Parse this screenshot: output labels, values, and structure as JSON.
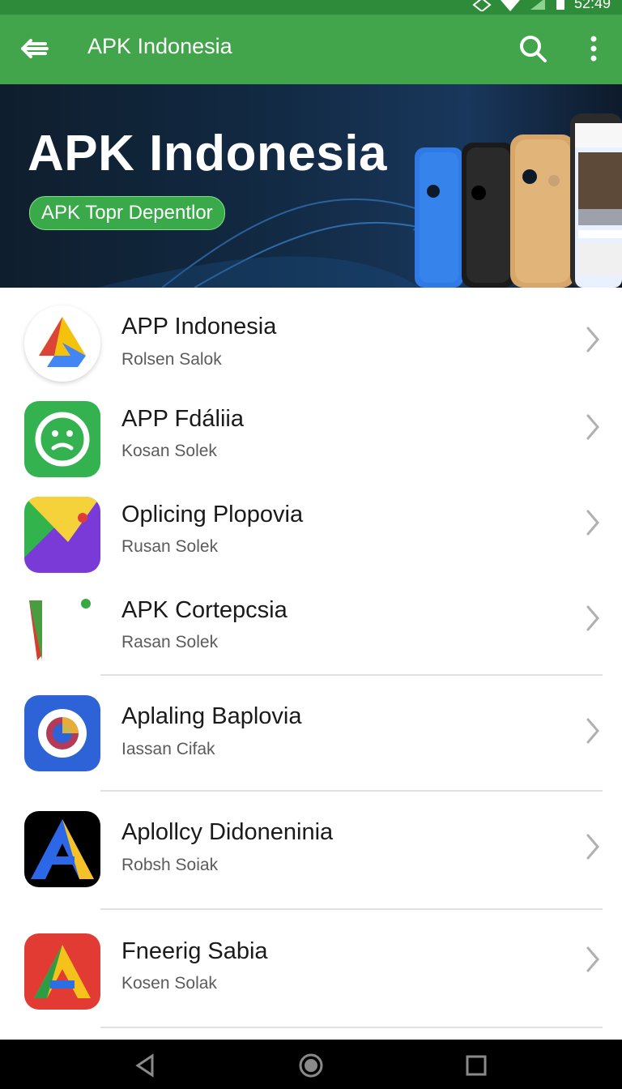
{
  "status_bar": {
    "time": "52:49"
  },
  "app_bar": {
    "title": "APK Indonesia"
  },
  "banner": {
    "headline": "APK Indonesia",
    "pill_text": "APK Topr Depentlor"
  },
  "apps": [
    {
      "title": "APP Indonesia",
      "subtitle": "Rolsen Salok"
    },
    {
      "title": "APP Fdáliia",
      "subtitle": "Kosan Solek"
    },
    {
      "title": "Oplicing Plopovia",
      "subtitle": "Rusan Solek"
    },
    {
      "title": "APK Cortepcsia",
      "subtitle": "Rasan Solek"
    },
    {
      "title": "Aplaling Baplovia",
      "subtitle": "Iassan Cifak"
    },
    {
      "title": "Aplollcy Didoneninia",
      "subtitle": "Robsh Soiak"
    },
    {
      "title": "Fneerig Sabia",
      "subtitle": "Kosen Solak"
    }
  ],
  "colors": {
    "status_bar": "#2e8b3a",
    "app_bar": "#43a54b",
    "accent_green": "#39a94a",
    "banner_dark": "#122a44",
    "nav_bar": "#000000"
  },
  "icons": {
    "app_bar": [
      "arrow-back-icon",
      "search-icon",
      "more-vert-icon"
    ],
    "status_bar": [
      "signal-icon",
      "wifi-icon",
      "battery-icon"
    ],
    "navigation": [
      "back-icon",
      "home-icon",
      "recents-icon"
    ],
    "list_item_icons": [
      "drive-triangle-icon",
      "smiley-face-icon",
      "folded-color-icon",
      "paper-icon",
      "circle-logo-icon",
      "letter-a-icon",
      "letter-a-red-icon"
    ]
  }
}
